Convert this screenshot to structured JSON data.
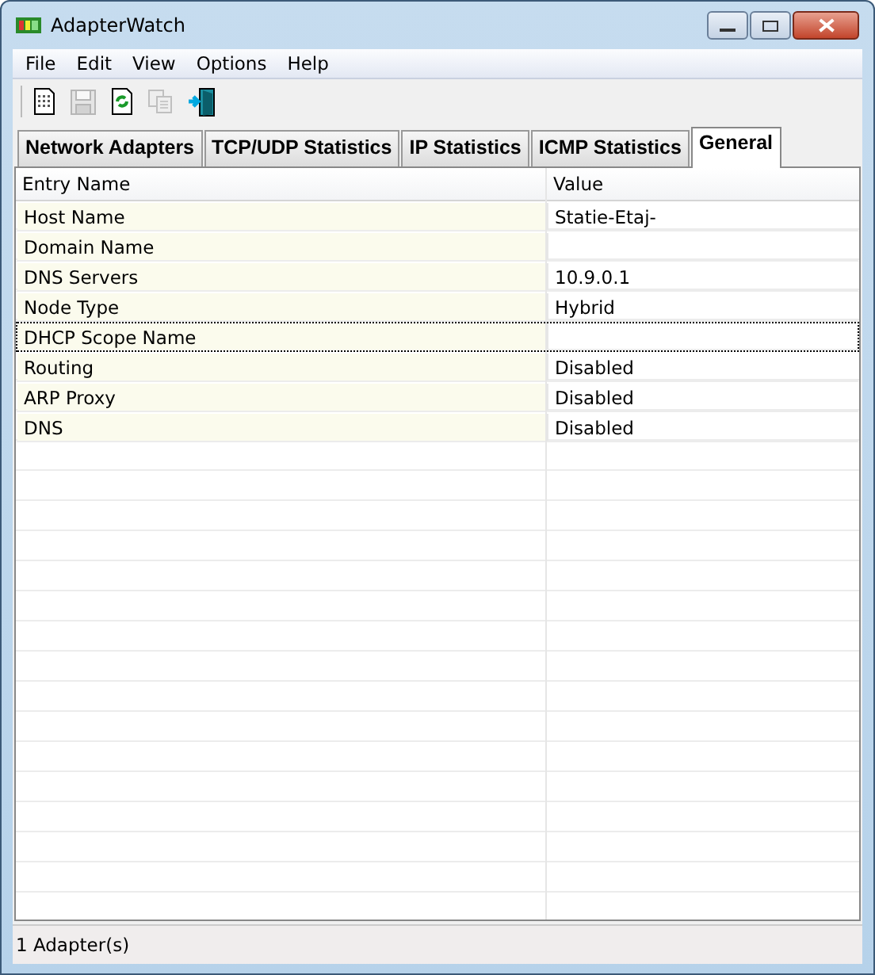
{
  "window": {
    "title": "AdapterWatch"
  },
  "menu": [
    "File",
    "Edit",
    "View",
    "Options",
    "Help"
  ],
  "toolbar": [
    {
      "kind": "new",
      "disabled": false
    },
    {
      "kind": "save",
      "disabled": true
    },
    {
      "kind": "refresh",
      "disabled": false
    },
    {
      "kind": "copy",
      "disabled": true
    },
    {
      "kind": "exit",
      "disabled": false
    }
  ],
  "tabs": [
    {
      "label": "Network Adapters",
      "selected": false
    },
    {
      "label": "TCP/UDP Statistics",
      "selected": false
    },
    {
      "label": "IP Statistics",
      "selected": false
    },
    {
      "label": "ICMP Statistics",
      "selected": false
    },
    {
      "label": "General",
      "selected": true
    }
  ],
  "table": {
    "columns": [
      "Entry Name",
      "Value"
    ],
    "rows": [
      {
        "name": "Host Name",
        "value": "Statie-Etaj-",
        "focused": false
      },
      {
        "name": "Domain Name",
        "value": "",
        "focused": false
      },
      {
        "name": "DNS Servers",
        "value": "10.9.0.1",
        "focused": false
      },
      {
        "name": "Node Type",
        "value": "Hybrid",
        "focused": false
      },
      {
        "name": "DHCP Scope Name",
        "value": "",
        "focused": true
      },
      {
        "name": "Routing",
        "value": "Disabled",
        "focused": false
      },
      {
        "name": "ARP Proxy",
        "value": "Disabled",
        "focused": false
      },
      {
        "name": "DNS",
        "value": "Disabled",
        "focused": false
      }
    ]
  },
  "status_bar": "1 Adapter(s)"
}
